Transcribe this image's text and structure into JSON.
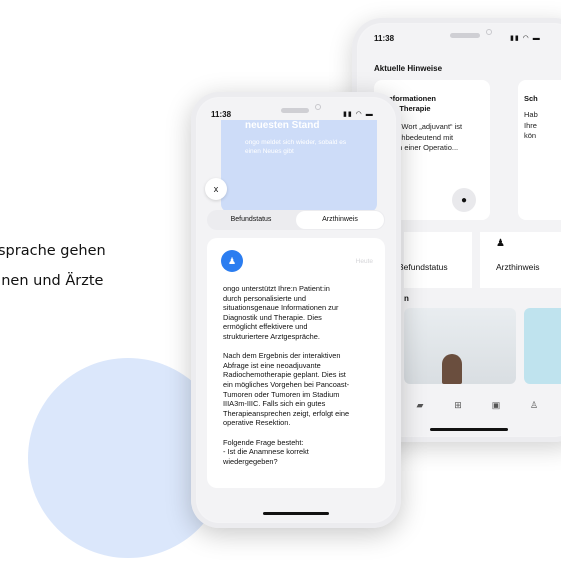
{
  "page": {
    "line1": "sprache gehen",
    "line2": "innen und Ärzte"
  },
  "back_phone": {
    "time": "11:38",
    "section_title": "Aktuelle Hinweise",
    "card1": {
      "title": "Informationen\nzur Therapie",
      "body": "Das Wort „adjuvant“ ist\ngleichbedeutend mit\nnach einer Operatio..."
    },
    "card2": {
      "title": "Sch",
      "body": "Hab\nIhre\nkön"
    },
    "tiles": [
      {
        "label": "Befundstatus",
        "icon": "document-icon"
      },
      {
        "label": "Arzthinweis",
        "icon": "doctor-icon"
      }
    ],
    "videos_title": "n",
    "nav_icons": [
      "folder-icon",
      "plus-icon",
      "chat-icon",
      "person-icon"
    ]
  },
  "front_phone": {
    "time": "11:38",
    "banner_title": "neuesten Stand",
    "banner_sub": "ongo meldet sich wieder, sobald es\neinen Neues gibt",
    "close_label": "x",
    "tabs": [
      {
        "label": "Befundstatus",
        "active": false
      },
      {
        "label": "Arzthinweis",
        "active": true
      }
    ],
    "message": {
      "date": "Heute",
      "text": "ongo unterstützt Ihre:n Patient:in\ndurch personalisierte und\nsituationsgenaue Informationen zur\nDiagnostik und Therapie. Dies\nermöglicht effektivere und\nstrukturiertere Arztgespräche.\n\nNach dem Ergebnis der interaktiven\nAbfrage ist eine neoadjuvante\nRadiochemotherapie geplant. Dies ist\nein mögliches Vorgehen bei Pancoast-\nTumoren oder Tumoren im Stadium\nIIIA3m-IIIC. Falls sich ein gutes\nTherapieansprechen zeigt, erfolgt eine\noperative Resektion.\n\nFolgende Frage besteht:\n- Ist die Anamnese korrekt\nwiedergegeben?"
    }
  },
  "colors": {
    "accent": "#2b7df0",
    "panel": "#cddcf8",
    "circle": "#dbe7fb"
  }
}
